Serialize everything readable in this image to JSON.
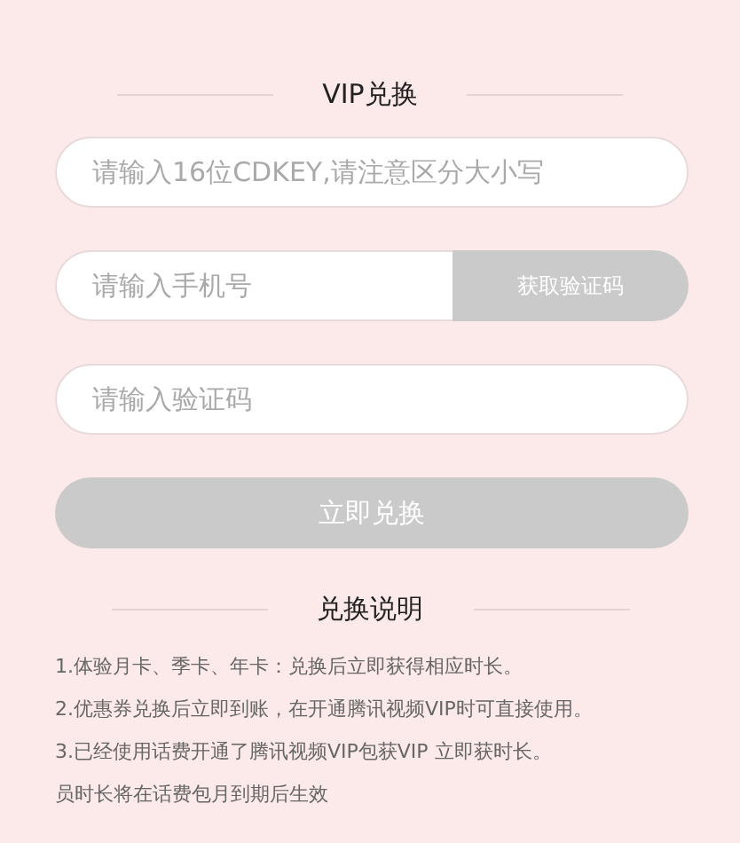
{
  "title": "VIP兑换",
  "fields": [
    {
      "placeholder": "请输入16位CDKEY,请注意区分大小写"
    },
    {
      "placeholder": "请输入手机号",
      "button": "获取验证码"
    },
    {
      "placeholder": "请输入验证码"
    }
  ],
  "submit": {
    "label": "立即兑换",
    "disabled": true
  },
  "notes_title": "兑换说明",
  "notes": [
    "1.体验月卡、季卡、年卡：兑换后立即获得相应时长。",
    "2.优惠券兑换后立即到账，在开通腾讯视频VIP时可直接使用。",
    "3.已经使用话费开通了腾讯视频VIP包获VIP  立即获时长。",
    "员时长将在话费包月到期后生效"
  ]
}
